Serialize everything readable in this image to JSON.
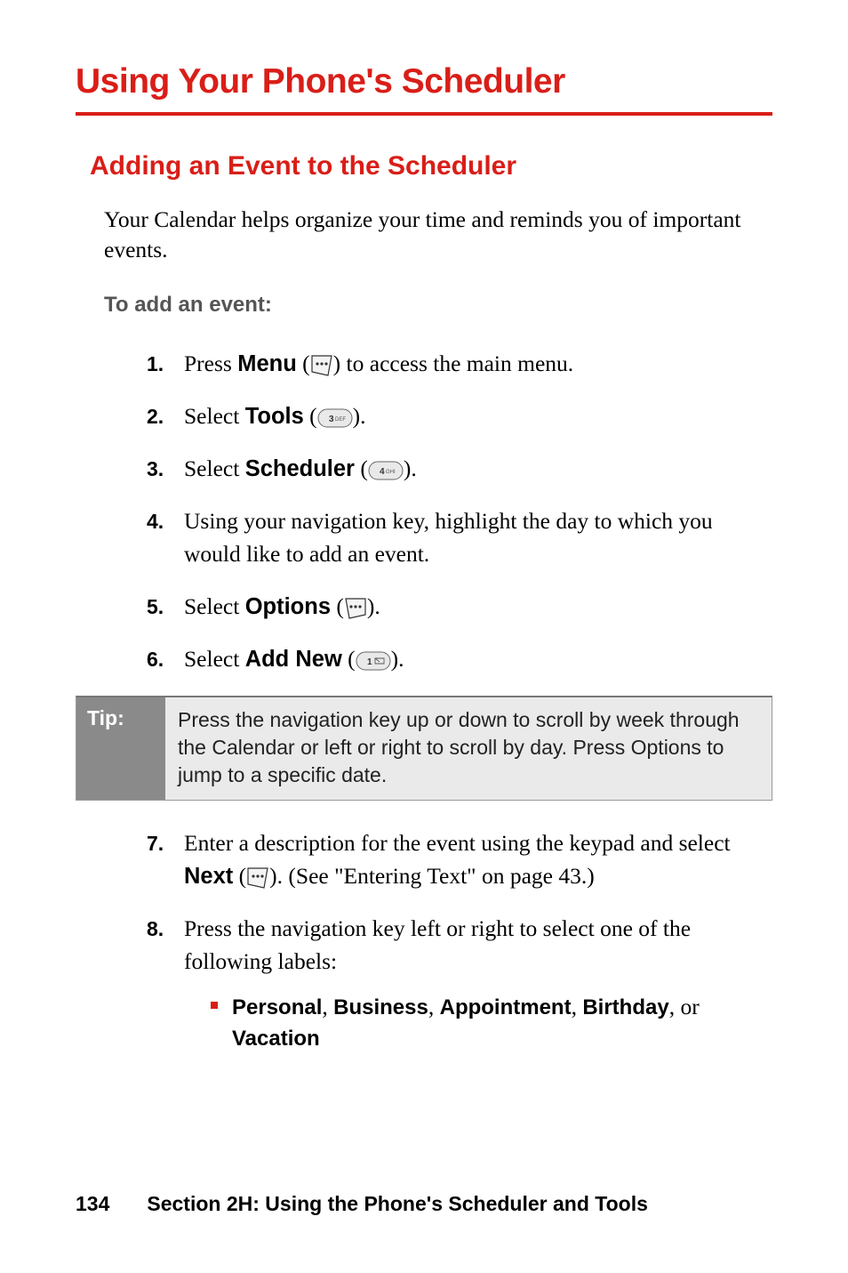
{
  "h1": "Using Your Phone's Scheduler",
  "h2": "Adding an Event to the Scheduler",
  "intro": "Your Calendar helps organize your time and reminds you of important events.",
  "subhead": "To add an event:",
  "steps": {
    "s1_a": "Press ",
    "s1_menu": "Menu",
    "s1_b": " (",
    "s1_c": ") to access the main menu.",
    "s2_a": "Select ",
    "s2_tools": "Tools",
    "s2_b": " (",
    "s2_c": ").",
    "s3_a": "Select ",
    "s3_sched": "Scheduler",
    "s3_b": " (",
    "s3_c": ").",
    "s4": "Using your navigation key, highlight the day to which you would like to add an event.",
    "s5_a": "Select ",
    "s5_opts": "Options",
    "s5_b": " (",
    "s5_c": ").",
    "s6_a": "Select ",
    "s6_add": "Add New",
    "s6_b": " (",
    "s6_c": ").",
    "s7_a": "Enter a description for the event using the keypad and select ",
    "s7_next": "Next",
    "s7_b": " (",
    "s7_c": "). (See \"Entering Text\" on page 43.)",
    "s8_a": "Press the navigation key left or right to select one of the following labels:"
  },
  "nums": {
    "n1": "1.",
    "n2": "2.",
    "n3": "3.",
    "n4": "4.",
    "n5": "5.",
    "n6": "6.",
    "n7": "7.",
    "n8": "8."
  },
  "tip": {
    "label": "Tip:",
    "body": "Press the navigation key up or down to scroll by week through the Calendar or left or right to scroll by day. Press Options to jump to a specific date."
  },
  "labels": {
    "personal": "Personal",
    "business": "Business",
    "appointment": "Appointment",
    "birthday": "Birthday",
    "or": ", or",
    "vacation": "Vacation",
    "sep": ", "
  },
  "footer": {
    "page": "134",
    "section": "Section 2H: Using the Phone's Scheduler and Tools"
  },
  "icons": {
    "key3": "3 DEF",
    "key4": "4 GHI",
    "key1": "1"
  }
}
